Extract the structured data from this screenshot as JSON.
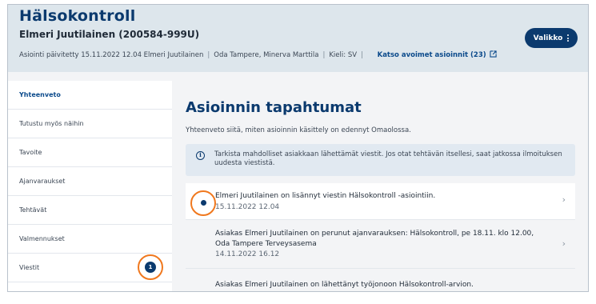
{
  "header": {
    "title": "Hälsokontroll",
    "patient": "Elmeri Juutilainen (200584-999U)",
    "updated": "Asiointi päivitetty 15.11.2022 12.04 Elmeri Juutilainen",
    "handlers": "Oda Tampere, Minerva Marttila",
    "language": "Kieli: SV",
    "separator": "|",
    "open_link": "Katso avoimet asioinnit (23)",
    "menu_label": "Valikko"
  },
  "sidebar": {
    "items": [
      {
        "label": "Yhteenveto"
      },
      {
        "label": "Tutustu myös näihin"
      },
      {
        "label": "Tavoite"
      },
      {
        "label": "Ajanvaraukset"
      },
      {
        "label": "Tehtävät"
      },
      {
        "label": "Valmennukset"
      },
      {
        "label": "Viestit",
        "badge": "1"
      }
    ]
  },
  "main": {
    "title": "Asioinnin tapahtumat",
    "subtitle": "Yhteenveto siitä, miten asioinnin käsittely on edennyt Omaolossa.",
    "info": "Tarkista mahdolliset asiakkaan lähettämät viestit. Jos otat tehtävän itsellesi, saat jatkossa ilmoituksen uudesta viestistä.",
    "info_icon_glyph": "i",
    "chevron_glyph": "›",
    "events": [
      {
        "text": "Elmeri Juutilainen on lisännyt viestin Hälsokontroll -asiointiin.",
        "date": "15.11.2022 12.04",
        "unread": true
      },
      {
        "text_line1": "Asiakas Elmeri Juutilainen on perunut ajanvarauksen: Hälsokontroll, pe 18.11. klo 12.00,",
        "text_line2": "Oda Tampere Terveysasema",
        "date": "14.11.2022 16.12",
        "unread": false
      },
      {
        "text": "Asiakas Elmeri Juutilainen on lähettänyt työjonoon Hälsokontroll-arvion.",
        "unread": false
      }
    ]
  },
  "colors": {
    "brand": "#0b3a6e",
    "highlight_ring": "#f0781e",
    "header_bg": "#dde6ec",
    "info_bg": "#e1e9f1"
  }
}
